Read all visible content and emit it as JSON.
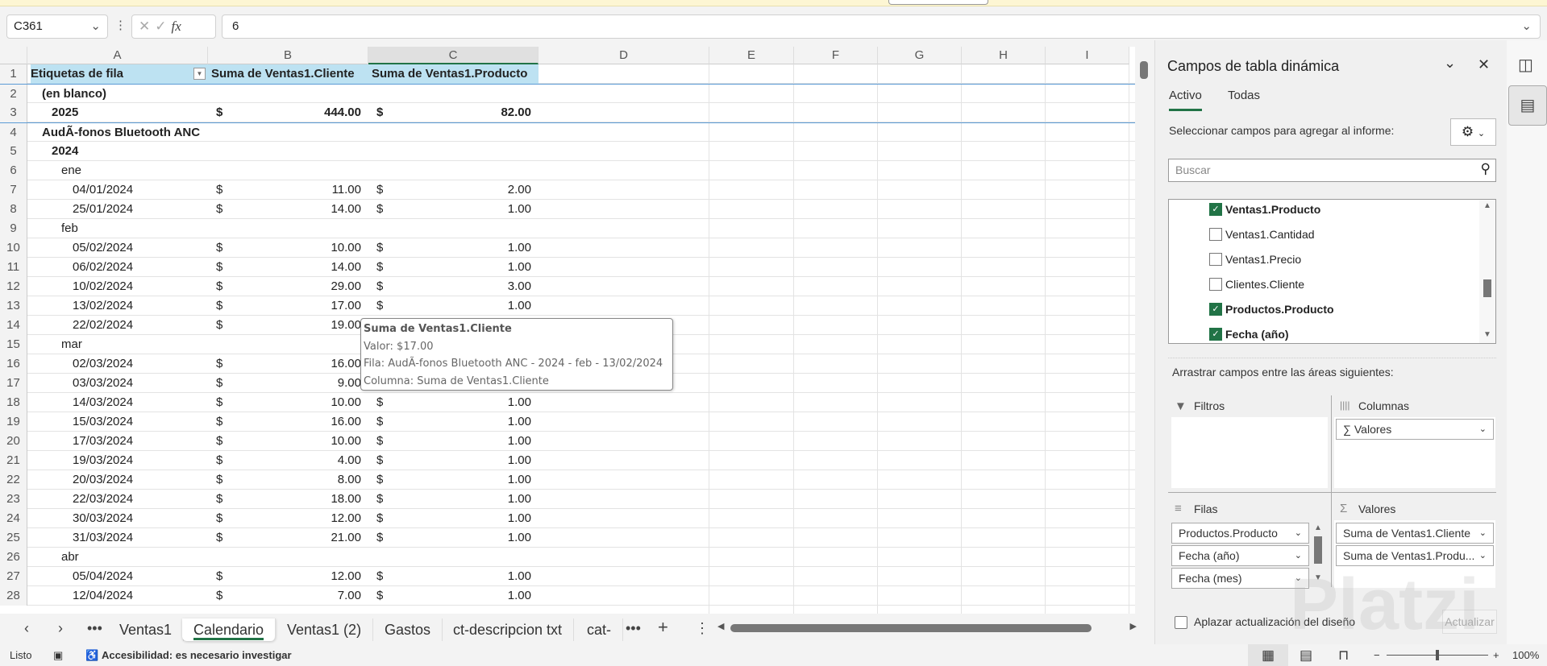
{
  "formula_bar": {
    "name_box": "C361",
    "formula_value": "6",
    "cancel_icon": "✕",
    "enter_icon": "✓",
    "fx_label": "fx"
  },
  "columns": [
    "A",
    "B",
    "C",
    "D",
    "E",
    "F",
    "G",
    "H",
    "I"
  ],
  "rows": [
    {
      "n": "1",
      "a": "Etiquetas de fila",
      "b": "Suma de Ventas1.Cliente",
      "c": "Suma de Ventas1.Producto",
      "type": "header"
    },
    {
      "n": "2",
      "a": "(en blanco)",
      "type": "group"
    },
    {
      "n": "3",
      "a": "2025",
      "b": "444.00",
      "c": "82.00",
      "type": "year"
    },
    {
      "n": "4",
      "a": "AudÃ-fonos Bluetooth ANC",
      "type": "group"
    },
    {
      "n": "5",
      "a": "2024",
      "type": "year"
    },
    {
      "n": "6",
      "a": "ene",
      "type": "month"
    },
    {
      "n": "7",
      "a": "04/01/2024",
      "b": "11.00",
      "c": "2.00",
      "type": "date"
    },
    {
      "n": "8",
      "a": "25/01/2024",
      "b": "14.00",
      "c": "1.00",
      "type": "date"
    },
    {
      "n": "9",
      "a": "feb",
      "type": "month"
    },
    {
      "n": "10",
      "a": "05/02/2024",
      "b": "10.00",
      "c": "1.00",
      "type": "date"
    },
    {
      "n": "11",
      "a": "06/02/2024",
      "b": "14.00",
      "c": "1.00",
      "type": "date"
    },
    {
      "n": "12",
      "a": "10/02/2024",
      "b": "29.00",
      "c": "3.00",
      "type": "date"
    },
    {
      "n": "13",
      "a": "13/02/2024",
      "b": "17.00",
      "c": "1.00",
      "type": "date"
    },
    {
      "n": "14",
      "a": "22/02/2024",
      "b": "19.00",
      "type": "date"
    },
    {
      "n": "15",
      "a": "mar",
      "type": "month"
    },
    {
      "n": "16",
      "a": "02/03/2024",
      "b": "16.00",
      "type": "date"
    },
    {
      "n": "17",
      "a": "03/03/2024",
      "b": "9.00",
      "type": "date"
    },
    {
      "n": "18",
      "a": "14/03/2024",
      "b": "10.00",
      "c": "1.00",
      "type": "date"
    },
    {
      "n": "19",
      "a": "15/03/2024",
      "b": "16.00",
      "c": "1.00",
      "type": "date"
    },
    {
      "n": "20",
      "a": "17/03/2024",
      "b": "10.00",
      "c": "1.00",
      "type": "date"
    },
    {
      "n": "21",
      "a": "19/03/2024",
      "b": "4.00",
      "c": "1.00",
      "type": "date"
    },
    {
      "n": "22",
      "a": "20/03/2024",
      "b": "8.00",
      "c": "1.00",
      "type": "date"
    },
    {
      "n": "23",
      "a": "22/03/2024",
      "b": "18.00",
      "c": "1.00",
      "type": "date"
    },
    {
      "n": "24",
      "a": "30/03/2024",
      "b": "12.00",
      "c": "1.00",
      "type": "date"
    },
    {
      "n": "25",
      "a": "31/03/2024",
      "b": "21.00",
      "c": "1.00",
      "type": "date"
    },
    {
      "n": "26",
      "a": "abr",
      "type": "month"
    },
    {
      "n": "27",
      "a": "05/04/2024",
      "b": "12.00",
      "c": "1.00",
      "type": "date"
    },
    {
      "n": "28",
      "a": "12/04/2024",
      "b": "7.00",
      "c": "1.00",
      "type": "date"
    }
  ],
  "currency": "$",
  "tooltip": {
    "title": "Suma de Ventas1.Cliente",
    "value": "Valor:  $17.00",
    "row": "Fila: AudÃ-fonos Bluetooth ANC - 2024 - feb - 13/02/2024",
    "column": "Columna: Suma de Ventas1.Cliente"
  },
  "sheet_tabs": [
    "Ventas1",
    "Calendario",
    "Ventas1 (2)",
    "Gastos",
    "ct-descripcion txt",
    "cat-"
  ],
  "active_tab": "Calendario",
  "status": {
    "ready": "Listo",
    "accessibility": "Accesibilidad: es necesario investigar",
    "zoom": "100%",
    "zoom_level_percent": 100
  },
  "pivot_panel": {
    "title": "Campos de tabla dinámica",
    "tabs": [
      "Activo",
      "Todas"
    ],
    "select_label": "Seleccionar campos para agregar al informe:",
    "search_placeholder": "Buscar",
    "fields": [
      {
        "label": "Ventas1.Producto",
        "checked": true
      },
      {
        "label": "Ventas1.Cantidad",
        "checked": false
      },
      {
        "label": "Ventas1.Precio",
        "checked": false
      },
      {
        "label": "Clientes.Cliente",
        "checked": false
      },
      {
        "label": "Productos.Producto",
        "checked": true
      },
      {
        "label": "Fecha (año)",
        "checked": true
      }
    ],
    "drag_label": "Arrastrar campos entre las áreas siguientes:",
    "areas": {
      "filters": "Filtros",
      "columns": "Columnas",
      "rows": "Filas",
      "values": "Valores"
    },
    "columns_items": [
      "Valores"
    ],
    "rows_items": [
      "Productos.Producto",
      "Fecha (año)",
      "Fecha (mes)"
    ],
    "values_items": [
      "Suma de Ventas1.Cliente",
      "Suma de Ventas1.Produ..."
    ],
    "defer_label": "Aplazar actualización del diseño",
    "update_button": "Actualizar"
  },
  "watermark": "Platzi"
}
